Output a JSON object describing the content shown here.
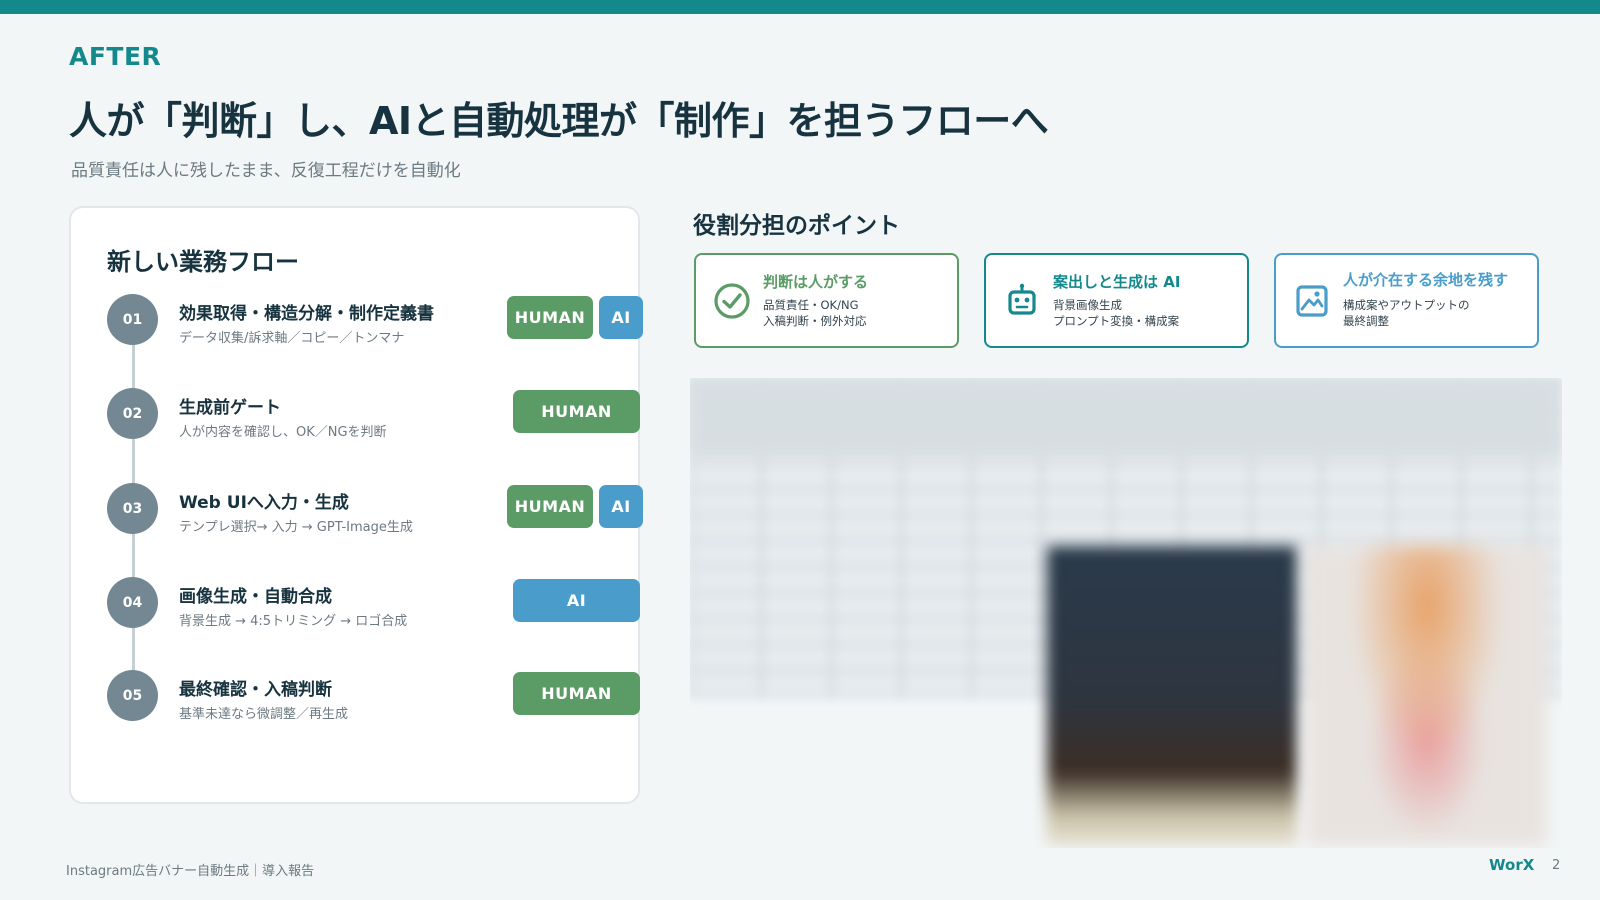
{
  "header": {
    "eyebrow": "AFTER",
    "title": "人が「判断」し、AIと自動処理が「制作」を担うフローへ",
    "subtitle": "品質責任は人に残したまま、反復工程だけを自動化"
  },
  "flow": {
    "title": "新しい業務フロー",
    "steps": [
      {
        "num": "01",
        "title": "効果取得・構造分解・制作定義書",
        "desc": "データ収集/訴求軸／コピー／トンマナ",
        "badges": [
          "HUMAN",
          "AI"
        ]
      },
      {
        "num": "02",
        "title": "生成前ゲート",
        "desc": "人が内容を確認し、OK／NGを判断",
        "badges": [
          "HUMAN"
        ]
      },
      {
        "num": "03",
        "title": "Web UIへ入力・生成",
        "desc": "テンプレ選択→ 入力 → GPT-Image生成",
        "badges": [
          "HUMAN",
          "AI"
        ]
      },
      {
        "num": "04",
        "title": "画像生成・自動合成",
        "desc": "背景生成 → 4:5トリミング → ロゴ合成",
        "badges": [
          "AI"
        ]
      },
      {
        "num": "05",
        "title": "最終確認・入稿判断",
        "desc": "基準未達なら微調整／再生成",
        "badges": [
          "HUMAN"
        ]
      }
    ]
  },
  "points": {
    "title": "役割分担のポイント",
    "cards": [
      {
        "title": "判断は人がする",
        "lines": [
          "品質責任・OK/NG",
          "入稿判断・例外対応"
        ],
        "icon": "check-circle-icon",
        "color": "#5b9c66"
      },
      {
        "title": "案出しと生成は AI",
        "lines": [
          "背景画像生成",
          "プロンプト変換・構成案"
        ],
        "icon": "robot-icon",
        "color": "#14898c"
      },
      {
        "title": "人が介在する余地を残す",
        "lines": [
          "構成案やアウトプットの",
          "最終調整"
        ],
        "icon": "image-edit-icon",
        "color": "#4a9ccb"
      }
    ]
  },
  "footer": {
    "left": "Instagram広告バナー自動生成｜導入報告",
    "brand": "WorX",
    "page": "2"
  },
  "colors": {
    "accent": "#14898c",
    "human": "#5b9c66",
    "ai": "#4a9ccb"
  }
}
